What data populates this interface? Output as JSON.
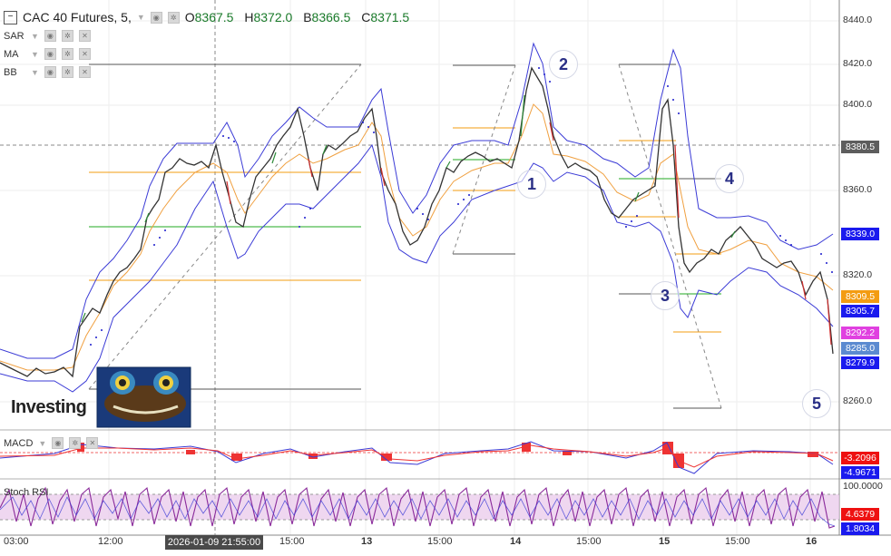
{
  "header": {
    "symbol": "CAC 40 Futures, 5,",
    "open_label": "O",
    "open": "8367.5",
    "high_label": "H",
    "high": "8372.0",
    "low_label": "B",
    "low": "8366.5",
    "close_label": "C",
    "close": "8371.5"
  },
  "indicators": [
    {
      "name": "SAR"
    },
    {
      "name": "MA"
    },
    {
      "name": "BB"
    }
  ],
  "price_axis": {
    "ticks": [
      "8440.0",
      "8420.0",
      "8400.0",
      "8380.5",
      "8360.0",
      "8339.0",
      "8320.0",
      "8309.5",
      "8305.7",
      "8292.2",
      "8285.0",
      "8279.9",
      "8260.0"
    ]
  },
  "price_labels": [
    {
      "text": "8380.5",
      "color": "#5d5d5d"
    },
    {
      "text": "8339.0",
      "color": "#1a1aee"
    },
    {
      "text": "8309.5",
      "color": "#f39c12"
    },
    {
      "text": "8305.7",
      "color": "#1a1aee"
    },
    {
      "text": "8292.2",
      "color": "#e040e0"
    },
    {
      "text": "8285.0",
      "color": "#5b8ad0"
    },
    {
      "text": "8279.9",
      "color": "#1a1aee"
    }
  ],
  "wave_labels": [
    "1",
    "2",
    "3",
    "4",
    "5"
  ],
  "logo": {
    "text": "Investing"
  },
  "macd": {
    "title": "MACD",
    "values": [
      {
        "text": "-3.2096",
        "color": "#ee1111"
      },
      {
        "text": "-4.9671",
        "color": "#1a1aee"
      }
    ]
  },
  "stoch_rsi": {
    "title": "Stoch RSI",
    "values": [
      {
        "text": "100.0000",
        "color": "#ffffff"
      },
      {
        "text": "4.6379",
        "color": "#ee1111"
      },
      {
        "text": "1.8034",
        "color": "#1a1aee"
      }
    ]
  },
  "time_axis": {
    "ticks": [
      "03:00",
      "12:00",
      "15:00",
      "13",
      "15:00",
      "14",
      "15:00",
      "15",
      "15:00",
      "16"
    ],
    "crosshair_label": "2026-01-09 21:55:00"
  },
  "colors": {
    "bollinger": "#3b3bd6",
    "sar": "#1a1acc",
    "ma": "#f0a040",
    "fib_orange": "#f39c12",
    "fib_green": "#22aa22",
    "up_candle": "#2e8b3a",
    "down_candle": "#d03030",
    "stoch_band": "#e8c6ea",
    "stoch_line": "#8a2a9a"
  }
}
